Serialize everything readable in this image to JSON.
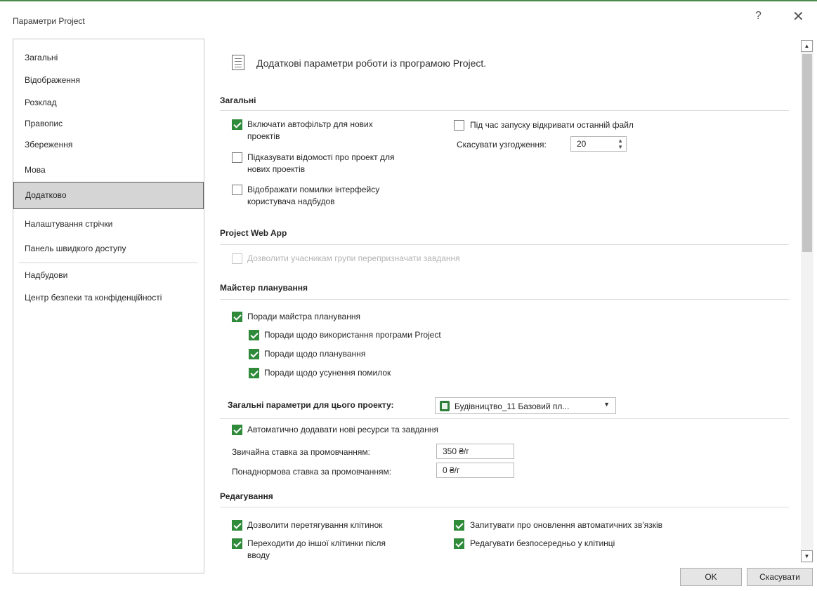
{
  "window": {
    "title": "Параметри Project",
    "help": "?",
    "close": "✕"
  },
  "sidebar": {
    "items": [
      {
        "label": "Загальні",
        "selected": false
      },
      {
        "label": "Відображення",
        "selected": false
      },
      {
        "label": "Розклад",
        "selected": false
      },
      {
        "label": "Правопис",
        "selected": false
      },
      {
        "label": "Збереження",
        "selected": false
      },
      {
        "label": "Мова",
        "selected": false
      },
      {
        "label": "Додатково",
        "selected": true
      },
      {
        "label": "Налаштування стрічки",
        "selected": false
      },
      {
        "label": "Панель швидкого доступу",
        "selected": false
      },
      {
        "label": "Надбудови",
        "selected": false
      },
      {
        "label": "Центр безпеки та конфіденційності",
        "selected": false
      }
    ]
  },
  "header": {
    "text": "Додаткові параметри роботи із програмою Project."
  },
  "general": {
    "title": "Загальні",
    "autofilter": {
      "label1": "Включати автофільтр для нових",
      "label2": "проектів",
      "checked": true
    },
    "project_info": {
      "label1": "Підказувати відомості про проект для",
      "label2": "нових проектів",
      "checked": false
    },
    "ui_errors": {
      "label1": "Відображати помилки інтерфейсу",
      "label2": "користувача надбудов",
      "checked": false
    },
    "open_last": {
      "label": "Під час запуску відкривати останній файл",
      "checked": false
    },
    "undo": {
      "label": "Скасувати узгодження:",
      "value": "20"
    }
  },
  "pwa": {
    "title": "Project Web App",
    "reassign": {
      "label": "Дозволити учасникам групи перепризначати завдання",
      "checked": false,
      "disabled": true
    }
  },
  "wizard": {
    "title": "Майстер планування",
    "advice": {
      "label": "Поради майстра планування",
      "checked": true
    },
    "usage": {
      "label": "Поради щодо використання програми Project",
      "checked": true
    },
    "scheduling": {
      "label": "Поради щодо планування",
      "checked": true
    },
    "errors": {
      "label": "Поради щодо усунення помилок",
      "checked": true
    }
  },
  "project_params": {
    "title": "Загальні параметри для цього проекту:",
    "project": "Будівництво_11 Базовий пл...",
    "auto_add": {
      "label": "Автоматично додавати нові ресурси та завдання",
      "checked": true
    },
    "std_rate": {
      "label": "Звичайна ставка за промовчанням:",
      "value": "350 ₴/г"
    },
    "ovt_rate": {
      "label": "Понаднормова ставка за промовчанням:",
      "value": "0 ₴/г"
    }
  },
  "editing": {
    "title": "Редагування",
    "drag": {
      "label": "Дозволити перетягування клітинок",
      "checked": true
    },
    "move_after1": "Переходити до іншої клітинки після",
    "move_after2": "вводу",
    "move_checked": true,
    "ask_update": {
      "label": "Запитувати про оновлення автоматичних зв'язків",
      "checked": true
    },
    "edit_direct": {
      "label": "Редагувати безпосередньо у клітинці",
      "checked": true
    }
  },
  "buttons": {
    "ok": "OK",
    "cancel": "Скасувати"
  }
}
